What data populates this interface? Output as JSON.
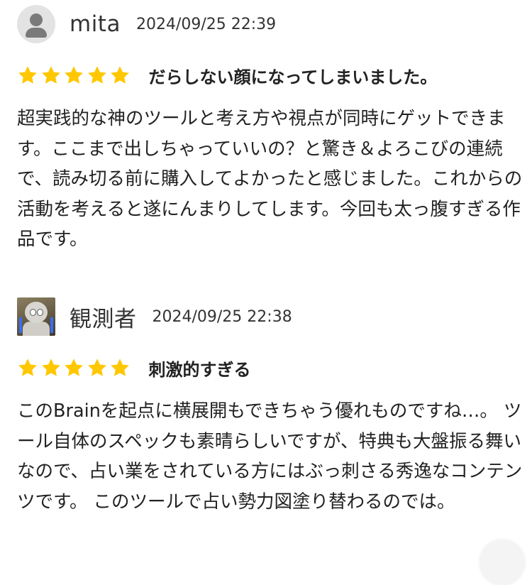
{
  "reviews": [
    {
      "username": "mita",
      "date": "2024/09/25 22:39",
      "avatar_icon": "default-user-icon",
      "rating": 5,
      "max_rating": 5,
      "title": "だらしない顔になってしまいました。",
      "body": "超実践的な神のツールと考え方や視点が同時にゲットできます。ここまで出しちゃっていいの？と驚き＆よろこびの連続で、読み切る前に購入してよかったと感じました。これからの活動を考えると遂にんまりしてします。今回も太っ腹すぎる作品です。"
    },
    {
      "username": "観測者",
      "date": "2024/09/25 22:38",
      "avatar_icon": "user-photo-avatar",
      "rating": 5,
      "max_rating": 5,
      "title": "刺激的すぎる",
      "body": "このBrainを起点に横展開もできちゃう優れものですね…。 ツール自体のスペックも素晴らしいですが、特典も大盤振る舞いなので、占い業をされている方にはぶっ刺さる秀逸なコンテンツです。 このツールで占い勢力図塗り替わるのでは。"
    }
  ],
  "colors": {
    "star": "#FFC700",
    "text": "#222222",
    "avatar_bg": "#E3E3E3",
    "avatar_fg": "#7A7A7A"
  }
}
